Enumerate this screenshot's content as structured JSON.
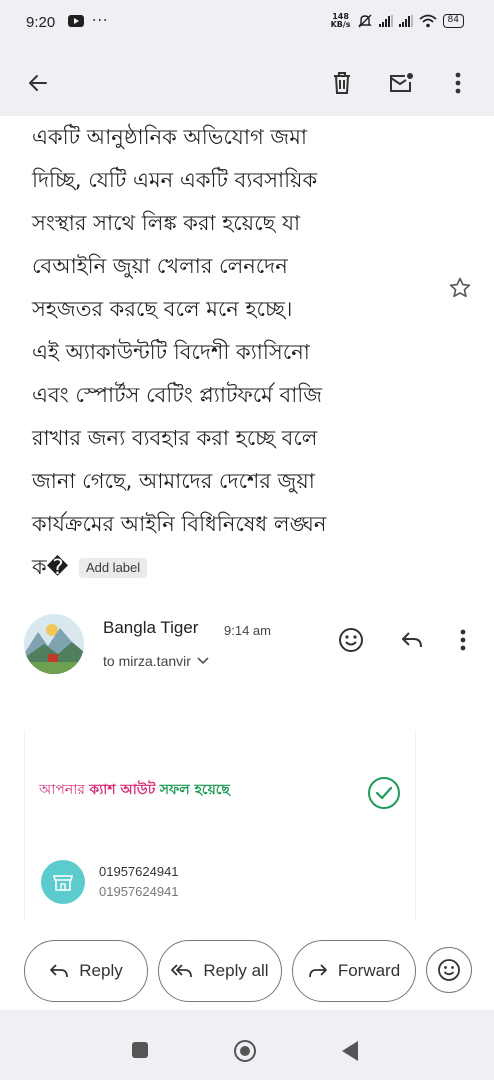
{
  "status_bar": {
    "time": "9:20",
    "net_speed_value": "148",
    "net_speed_unit": "KB/s",
    "battery": "84",
    "icons": [
      "youtube-icon",
      "more-dots-icon",
      "mute-icon",
      "signal-icon",
      "signal-icon",
      "wifi-icon",
      "battery-icon"
    ]
  },
  "toolbar": {
    "icons": [
      "back-arrow-icon",
      "delete-icon",
      "mark-unread-icon",
      "more-vert-icon"
    ]
  },
  "message": {
    "snippet_lines": [
      "একটি আনুষ্ঠানিক অভিযোগ জমা",
      "দিচ্ছি, যেটি এমন একটি ব্যবসায়িক",
      "সংস্থার সাথে লিঙ্ক করা হয়েছে যা",
      "বেআইনি জুয়া খেলার লেনদেন",
      "সহজতর করছে বলে মনে হচ্ছে।",
      "এই অ্যাকাউন্টটি বিদেশী ক্যাসিনো",
      "এবং স্পোর্টস বেটিং প্ল্যাটফর্মে বাজি",
      "রাখার জন্য ব্যবহার করা হচ্ছে বলে",
      "জানা গেছে, আমাদের দেশের জুয়া",
      "কার্যক্রমের আইনি বিধিনিষেধ লঙ্ঘন"
    ],
    "last_line": "ক",
    "replacement_char": "�",
    "add_label": "Add label"
  },
  "sender": {
    "name": "Bangla Tiger",
    "time": "9:14 am",
    "recipient": "to mirza.tanvir"
  },
  "card": {
    "text_part1": "আপনার",
    "text_part2": "ক্যাশ আউট",
    "text_part3": "সফল হয়েছে",
    "number_primary": "01957624941",
    "number_secondary": "01957624941",
    "accent_pink": "#d62f7a",
    "accent_green": "#1e9b57",
    "store_color": "#5ccbcd"
  },
  "actions": {
    "reply": "Reply",
    "reply_all": "Reply all",
    "forward": "Forward"
  }
}
